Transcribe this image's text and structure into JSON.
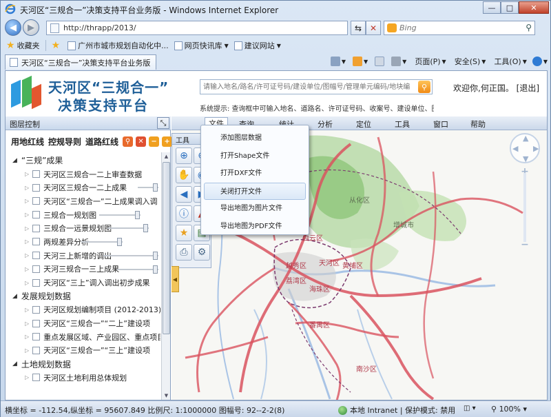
{
  "window": {
    "title": "天河区“三规合一”决策支持平台业务版 - Windows Internet Explorer",
    "minimize": "—",
    "maximize": "□",
    "close": "✕"
  },
  "browser": {
    "address": "http://thrapp/2013/",
    "search_placeholder": "Bing",
    "favorites_label": "收藏夹",
    "favorites": [
      {
        "label": "广州市城市规划自动化中..."
      },
      {
        "label": "网页快讯库"
      },
      {
        "label": "建议网站"
      }
    ],
    "tab_title": "天河区“三规合一”决策支持平台业务版",
    "commands": {
      "page": "页面(P)",
      "safety": "安全(S)",
      "tools": "工具(O)"
    }
  },
  "app": {
    "title_line1": "天河区“三规合一”",
    "title_line2": "决策支持平台",
    "search_placeholder": "请输入地名/路名/许可证号码/建设单位/图幅号/管理单元编码/地块编码/坐标等",
    "welcome": "欢迎你,何正国。",
    "logout": "[退出]",
    "tip": "系统提示:  查询框中可输入地名、道路名、许可证号码、收案号、建设单位、图幅号、管理"
  },
  "layer_panel": {
    "title": "图层控制",
    "tabs": [
      "用地红线",
      "控规导则",
      "道路红线"
    ],
    "tree": [
      {
        "type": "group",
        "label": "“三规”成果"
      },
      {
        "type": "leaf",
        "label": "天河区三规合一二上审查数据"
      },
      {
        "type": "leaf",
        "label": "天河区三规合一二上成果"
      },
      {
        "type": "leaf",
        "label": "天河区“三规合一”二上成果调入调"
      },
      {
        "type": "leaf",
        "label": "三规合一规划图"
      },
      {
        "type": "leaf",
        "label": "三规合一远景规划图"
      },
      {
        "type": "leaf",
        "label": "两规差异分析"
      },
      {
        "type": "leaf",
        "label": "天河三上新增的调出"
      },
      {
        "type": "leaf",
        "label": "天河三规合一三上成果"
      },
      {
        "type": "leaf",
        "label": "天河区“三上”调入调出初步成果"
      },
      {
        "type": "group",
        "label": "发展规划数据"
      },
      {
        "type": "leaf",
        "label": "天河区规划编制项目 (2012-2013)"
      },
      {
        "type": "leaf",
        "label": "天河区“三规合一”“二上”建设项"
      },
      {
        "type": "leaf",
        "label": "重点发展区域、产业园区、重点项目"
      },
      {
        "type": "leaf",
        "label": "天河区“三规合一”“三上”建设项"
      },
      {
        "type": "group",
        "label": "土地规划数据"
      },
      {
        "type": "leaf",
        "label": "天河区土地利用总体规划"
      }
    ]
  },
  "menu": {
    "items": [
      "文件",
      "查询",
      "统计",
      "分析",
      "定位",
      "工具",
      "窗口",
      "帮助"
    ]
  },
  "file_menu": {
    "items": [
      "添加图层数据",
      "打开Shape文件",
      "打开DXF文件",
      "关闭打开文件",
      "导出地图为图片文件",
      "导出地图为PDF文件"
    ]
  },
  "toolbox": {
    "title": "工具",
    "tools": [
      "zoom-in-icon",
      "zoom-out-icon",
      "pan-hand-icon",
      "globe-icon",
      "back-arrow-icon",
      "forward-icon",
      "info-icon",
      "measure-icon",
      "star-icon",
      "layers-icon",
      "print-icon",
      "settings-icon"
    ]
  },
  "map": {
    "labels": [
      "从化区",
      "增城市",
      "白云区",
      "黄埔区",
      "天河区",
      "荔湾区",
      "越秀区",
      "海珠区",
      "番禺区",
      "南沙区"
    ]
  },
  "statusbar": {
    "coords": "横坐标 = -112.54,纵坐标 = 95607.849 比例尺: 1:1000000 图幅号: 92--2-2(8)",
    "zone": "本地 Intranet | 保护模式: 禁用",
    "zoom": "100%"
  },
  "colors": {
    "title_blue": "#1f5f98",
    "road_red": "#d9535f",
    "forest_green": "#9cc98a"
  }
}
